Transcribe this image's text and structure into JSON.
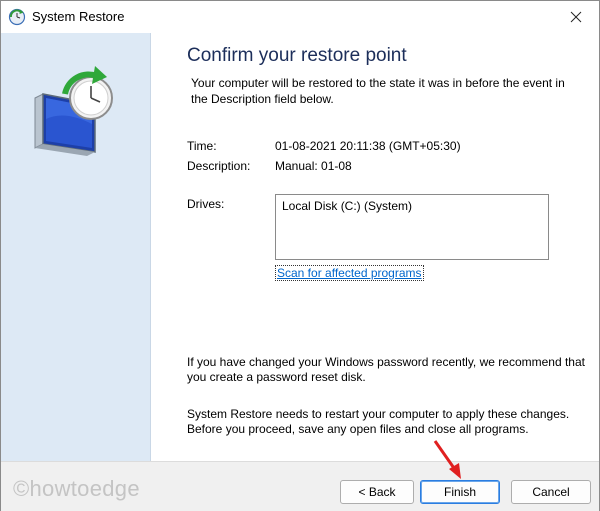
{
  "titlebar": {
    "title": "System Restore",
    "icon": "system-restore-icon",
    "close_icon": "close-icon"
  },
  "main": {
    "heading": "Confirm your restore point",
    "intro": "Your computer will be restored to the state it was in before the event in the Description field below.",
    "time_label": "Time:",
    "time_value": "01-08-2021 20:11:38 (GMT+05:30)",
    "description_label": "Description:",
    "description_value": "Manual: 01-08",
    "drives_label": "Drives:",
    "drives": [
      "Local Disk (C:) (System)"
    ],
    "scan_link": "Scan for affected programs",
    "password_note": "If you have changed your Windows password recently, we recommend that you create a password reset disk.",
    "restart_note": "System Restore needs to restart your computer to apply these changes. Before you proceed, save any open files and close all programs."
  },
  "footer": {
    "watermark": "©howtoedge",
    "back_label": "< Back",
    "finish_label": "Finish",
    "cancel_label": "Cancel"
  },
  "colors": {
    "heading": "#1c2e5a",
    "left_pane": "#dde9f5",
    "link": "#0066cc",
    "annotation_arrow": "#e02020"
  }
}
